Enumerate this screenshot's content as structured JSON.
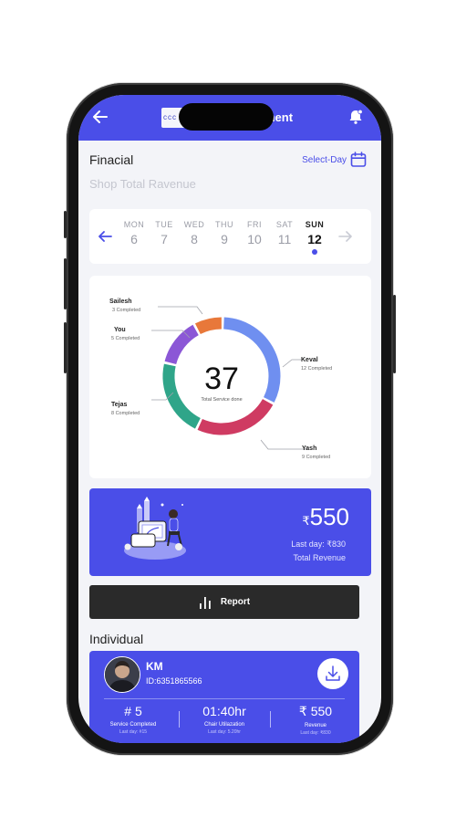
{
  "app": {
    "title": "ment",
    "logo_text": "ccc"
  },
  "financial": {
    "heading": "Finacial",
    "select_day_label": "Select-Day",
    "subtitle": "Shop Total Ravenue"
  },
  "week": {
    "days": [
      {
        "name": "MON",
        "date": "6"
      },
      {
        "name": "TUE",
        "date": "7"
      },
      {
        "name": "WED",
        "date": "8"
      },
      {
        "name": "THU",
        "date": "9"
      },
      {
        "name": "FRI",
        "date": "10"
      },
      {
        "name": "SAT",
        "date": "11"
      },
      {
        "name": "SUN",
        "date": "12"
      }
    ],
    "selected_index": 6
  },
  "services": {
    "total": "37",
    "total_label": "Total Service done",
    "staff": [
      {
        "name": "Sailesh",
        "completed": "3 Completed",
        "count": 3,
        "color": "#e8783a"
      },
      {
        "name": "You",
        "completed": "5 Completed",
        "count": 5,
        "color": "#8b57d6"
      },
      {
        "name": "Tejas",
        "completed": "8 Completed",
        "count": 8,
        "color": "#2fa589"
      },
      {
        "name": "Keval",
        "completed": "12 Completed",
        "count": 12,
        "color": "#6f8ff0"
      },
      {
        "name": "Yash",
        "completed": "9 Completed",
        "count": 9,
        "color": "#cf3b62"
      }
    ]
  },
  "revenue": {
    "currency": "₹",
    "amount": "550",
    "last_day": "Last day: ₹830",
    "label": "Total Revenue"
  },
  "report": {
    "label": "Report"
  },
  "individual": {
    "heading": "Individual",
    "name": "KM",
    "id": "ID:6351865566",
    "stats": [
      {
        "value": "#  5",
        "label": "Service Completed",
        "sub": "Last day: #15"
      },
      {
        "value": "01:40hr",
        "label": "Chair Utilazation",
        "sub": "Last day: 5.20hr"
      },
      {
        "value": "₹ 550",
        "label": "Revenue",
        "sub": "Last day: ₹830"
      }
    ]
  },
  "colors": {
    "accent": "#4a4ee8",
    "dark_button": "#2a2a2a"
  }
}
